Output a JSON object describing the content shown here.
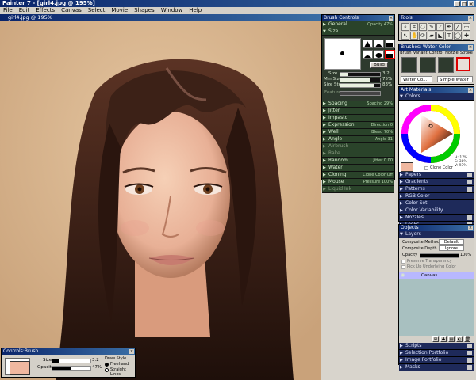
{
  "app": {
    "title": "Painter 7 - [girl4.jpg @ 195%]"
  },
  "menu": [
    "File",
    "Edit",
    "Effects",
    "Canvas",
    "Select",
    "Movie",
    "Shapes",
    "Window",
    "Help"
  ],
  "document": {
    "tab_title": "girl4.jpg @ 195%"
  },
  "brush_controls": {
    "title": "Brush Controls",
    "general": {
      "label": "General",
      "value": "Opacity 47%"
    },
    "size": {
      "label": "Size"
    },
    "build_label": "Build",
    "size_slider": {
      "label": "Size",
      "value": "3.2"
    },
    "min_size": {
      "label": "Min Size",
      "value": "75%"
    },
    "size_step": {
      "label": "Size Step",
      "value": "83%"
    },
    "feature_label": "Feature",
    "sections": [
      {
        "label": "Spacing",
        "value": "Spacing 29%"
      },
      {
        "label": "Jitter",
        "value": ""
      },
      {
        "label": "Impasto",
        "value": ""
      },
      {
        "label": "Expression",
        "value": "Direction 0"
      },
      {
        "label": "Well",
        "value": "Bleed 70%"
      },
      {
        "label": "Angle",
        "value": "Angle 31"
      },
      {
        "label": "Airbrush",
        "value": ""
      },
      {
        "label": "Rake",
        "value": ""
      },
      {
        "label": "Random",
        "value": "Jitter 0.00"
      },
      {
        "label": "Water",
        "value": ""
      },
      {
        "label": "Cloning",
        "value": "Clone Color Off"
      },
      {
        "label": "Mouse",
        "value": "Pressure 100%"
      },
      {
        "label": "Liquid Ink",
        "value": ""
      }
    ],
    "brush_accent": "#f0f0f0"
  },
  "tools": {
    "title": "Tools"
  },
  "brush_selector": {
    "title": "Brushes: Water Color",
    "tabs": [
      "Brush",
      "Variant",
      "Control",
      "Nozzle",
      "Stroke"
    ],
    "category": "Water Co...",
    "variant": "Simple Water"
  },
  "art_materials": {
    "title": "Art Materials",
    "colors_label": "Colors",
    "primary_color": "#f0b8a0",
    "readout": [
      "H: 17%",
      "S: 38%",
      "V: 93%"
    ],
    "clone_color_label": "Clone Color",
    "sections": [
      "Papers",
      "Gradients",
      "Patterns",
      "RGB Color",
      "Color Set",
      "Color Variability",
      "Nozzles",
      "Looks"
    ]
  },
  "objects": {
    "title": "Objects",
    "layers_label": "Layers",
    "composite_method_label": "Composite Method",
    "composite_method_value": "Default",
    "composite_depth_label": "Composite Depth",
    "composite_depth_value": "Ignore",
    "opacity_label": "Opacity",
    "opacity_value": "100%",
    "preserve_transparency": "Preserve Transparency",
    "pickup_underlying": "Pick Up Underlying Color",
    "layer_name": "Canvas",
    "sections": [
      "Scripts",
      "Selection Portfolio",
      "Image Portfolio",
      "Masks"
    ]
  },
  "controls_brush": {
    "title": "Controls:Brush",
    "size_label": "Size",
    "size_value": "3.2",
    "opacity_label": "Opacity",
    "opacity_value": "47%",
    "opacity_fraction": 0.47,
    "draw_style_label": "Draw Style",
    "freehand": "Freehand",
    "straight_lines": "Straight Lines",
    "color": "#f0b8a0"
  }
}
